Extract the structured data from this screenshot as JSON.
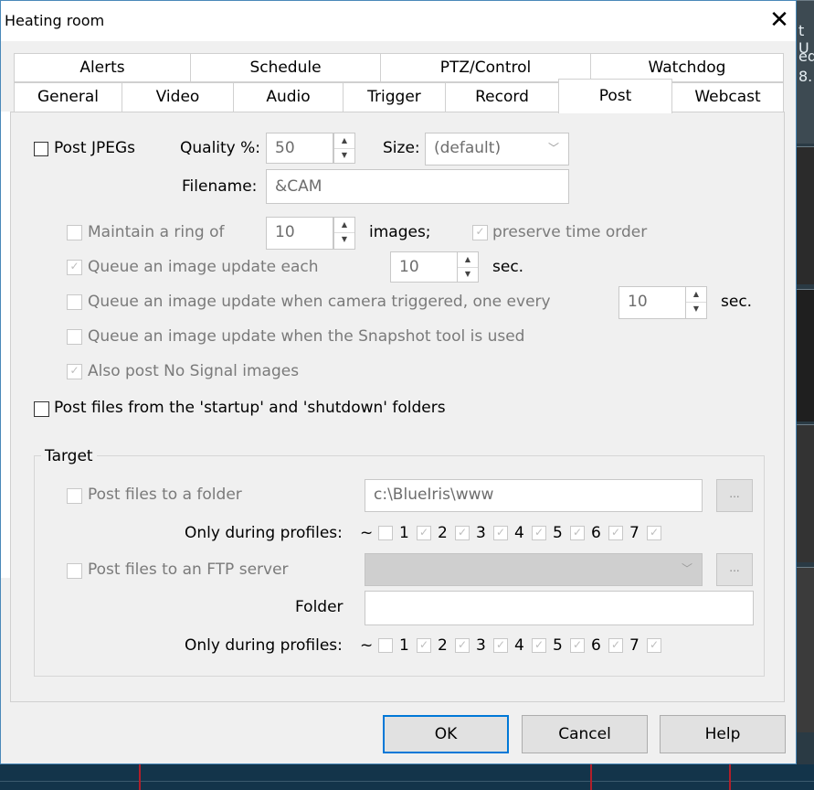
{
  "window": {
    "title": "Heating room",
    "close_glyph": "✕"
  },
  "background": {
    "right_texts": [
      "t U",
      "ed",
      "8."
    ]
  },
  "tabs": {
    "row1": [
      "Alerts",
      "Schedule",
      "PTZ/Control",
      "Watchdog"
    ],
    "row2": [
      "General",
      "Video",
      "Audio",
      "Trigger",
      "Record",
      "Post",
      "Webcast"
    ],
    "active": "Post"
  },
  "post": {
    "post_jpegs_label": "Post JPEGs",
    "post_jpegs_checked": false,
    "quality_label": "Quality %:",
    "quality_value": "50",
    "size_label": "Size:",
    "size_value": "(default)",
    "filename_label": "Filename:",
    "filename_value": "&CAM",
    "ring_label": "Maintain a ring of",
    "ring_value": "10",
    "images_label": "images;",
    "preserve_label": "preserve time order",
    "queue_each_label": "Queue an image update each",
    "queue_each_value": "10",
    "sec_label": "sec.",
    "queue_trigger_label": "Queue an image update when camera triggered, one every",
    "queue_trigger_value": "10",
    "queue_snapshot_label": "Queue an image update when the Snapshot tool is used",
    "no_signal_label": "Also post No Signal images",
    "startup_label": "Post files from the 'startup' and 'shutdown' folders"
  },
  "target": {
    "group_label": "Target",
    "folder_label": "Post files to a folder",
    "folder_path": "c:\\BlueIris\\www",
    "browse_label": "...",
    "profiles_label": "Only during profiles:",
    "tilde": "~",
    "profiles": [
      "1",
      "2",
      "3",
      "4",
      "5",
      "6",
      "7"
    ],
    "ftp_label": "Post files to an FTP server",
    "ftp_folder_label": "Folder",
    "ftp_folder_value": ""
  },
  "buttons": {
    "ok": "OK",
    "cancel": "Cancel",
    "help": "Help"
  },
  "icons": {
    "check": "✓",
    "spin_up": "▲",
    "spin_down": "▼",
    "chevron": "﹀"
  },
  "colors": {
    "accent": "#0078d7",
    "panel": "#f0f0f0",
    "disabled_text": "#7a7a7a"
  }
}
